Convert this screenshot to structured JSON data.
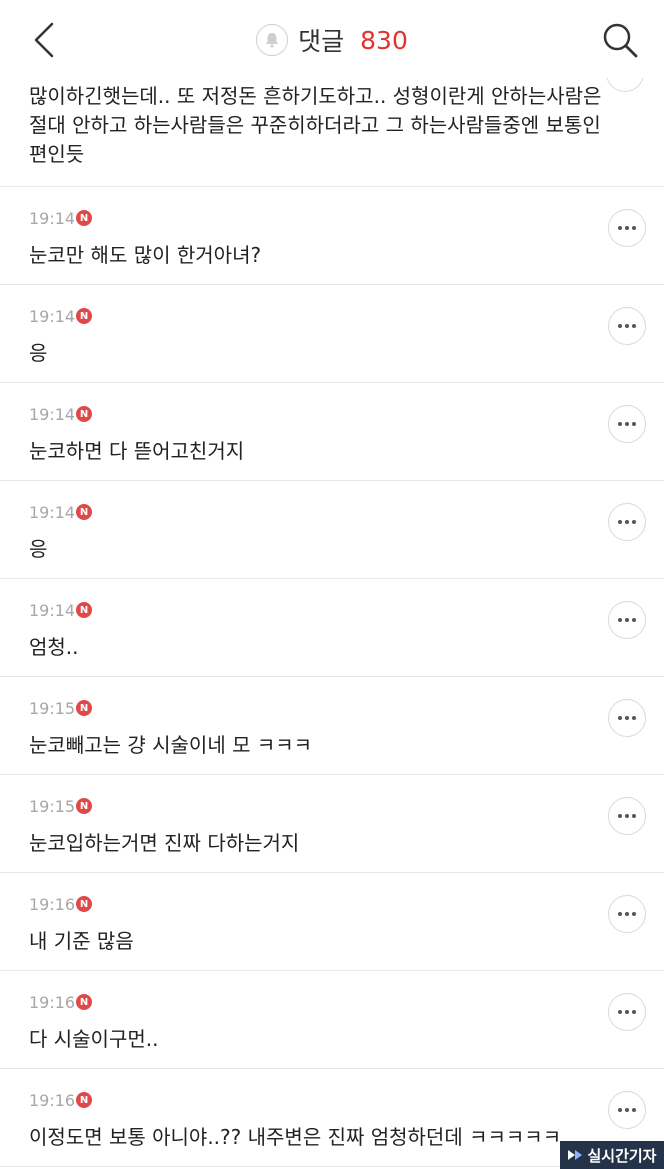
{
  "header": {
    "title": "댓글",
    "count": "830"
  },
  "first_comment": {
    "text": "많이하긴햇는데.. 또 저정돈 흔하기도하고.. 성형이란게 안하는사람은 절대 안하고 하는사람들은 꾸준히하더라고 그 하는사람들중엔 보통인 편인듯"
  },
  "comments": [
    {
      "time": "19:14",
      "badge": "N",
      "text": "눈코만 해도 많이 한거아녀?"
    },
    {
      "time": "19:14",
      "badge": "N",
      "text": "응"
    },
    {
      "time": "19:14",
      "badge": "N",
      "text": "눈코하면 다 뜯어고친거지"
    },
    {
      "time": "19:14",
      "badge": "N",
      "text": "응"
    },
    {
      "time": "19:14",
      "badge": "N",
      "text": "엄청.."
    },
    {
      "time": "19:15",
      "badge": "N",
      "text": "눈코빼고는 걍 시술이네 모 ㅋㅋㅋ"
    },
    {
      "time": "19:15",
      "badge": "N",
      "text": "눈코입하는거면 진짜 다하는거지"
    },
    {
      "time": "19:16",
      "badge": "N",
      "text": "내 기준 많음"
    },
    {
      "time": "19:16",
      "badge": "N",
      "text": "다 시술이구먼.."
    },
    {
      "time": "19:16",
      "badge": "N",
      "text": "이정도면 보통 아니야..?? 내주변은 진짜 엄청하던데 ㅋㅋㅋㅋㅋ"
    }
  ],
  "watermark": "실시간기자",
  "colors": {
    "accent": "#e0342f",
    "badge": "#de4a4a",
    "divider": "#e8e8e8",
    "time": "#a7a7a7"
  },
  "icons": {
    "back": "chevron-left-icon",
    "bell": "bell-icon",
    "search": "search-icon",
    "more": "more-dots-icon"
  }
}
